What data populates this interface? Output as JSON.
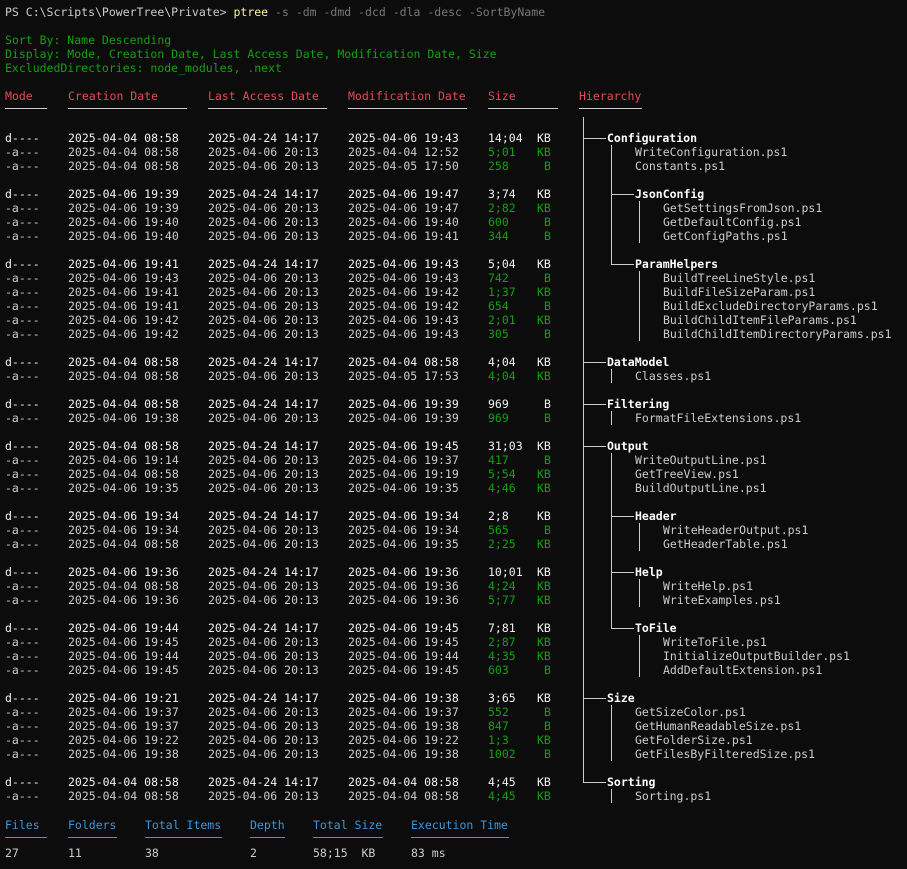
{
  "prompt": {
    "text": "PS C:\\Scripts\\PowerTree\\Private> ",
    "command": "ptree",
    "flags": " -s -dm -dmd -dcd -dla -desc -SortByName"
  },
  "info": {
    "sort": "Sort By: Name Descending",
    "display": "Display: Mode, Creation Date, Last Access Date, Modification Date, Size",
    "excluded": "ExcludedDirectories: node_modules, .next"
  },
  "headers": {
    "mode": "Mode",
    "creation": "Creation Date",
    "access": "Last Access Date",
    "modification": "Modification Date",
    "size": "Size",
    "hierarchy": "Hierarchy"
  },
  "rows": [
    {
      "mode": "d----",
      "c": "2025-04-04 08:58",
      "a": "2025-04-24 14:17",
      "m": "2025-04-06 19:43",
      "size": "14;04",
      "unit": "KB",
      "dir": true,
      "depth": 0,
      "name": "Configuration"
    },
    {
      "mode": "-a---",
      "c": "2025-04-04 08:58",
      "a": "2025-04-06 20:13",
      "m": "2025-04-04 12:52",
      "size": "5;01",
      "unit": "KB",
      "dir": false,
      "depth": 1,
      "name": "WriteConfiguration.ps1"
    },
    {
      "mode": "-a---",
      "c": "2025-04-04 08:58",
      "a": "2025-04-06 20:13",
      "m": "2025-04-05 17:50",
      "size": "258",
      "unit": "B",
      "dir": false,
      "depth": 1,
      "name": "Constants.ps1"
    },
    {
      "gap": true
    },
    {
      "mode": "d----",
      "c": "2025-04-06 19:39",
      "a": "2025-04-24 14:17",
      "m": "2025-04-06 19:47",
      "size": "3;74",
      "unit": "KB",
      "dir": true,
      "depth": 1,
      "name": "JsonConfig"
    },
    {
      "mode": "-a---",
      "c": "2025-04-06 19:39",
      "a": "2025-04-06 20:13",
      "m": "2025-04-06 19:47",
      "size": "2;82",
      "unit": "KB",
      "dir": false,
      "depth": 2,
      "name": "GetSettingsFromJson.ps1"
    },
    {
      "mode": "-a---",
      "c": "2025-04-06 19:40",
      "a": "2025-04-06 20:13",
      "m": "2025-04-06 19:40",
      "size": "600",
      "unit": "B",
      "dir": false,
      "depth": 2,
      "name": "GetDefaultConfig.ps1"
    },
    {
      "mode": "-a---",
      "c": "2025-04-06 19:40",
      "a": "2025-04-06 20:13",
      "m": "2025-04-06 19:41",
      "size": "344",
      "unit": "B",
      "dir": false,
      "depth": 2,
      "name": "GetConfigPaths.ps1"
    },
    {
      "gap": true
    },
    {
      "mode": "d----",
      "c": "2025-04-06 19:41",
      "a": "2025-04-24 14:17",
      "m": "2025-04-06 19:43",
      "size": "5;04",
      "unit": "KB",
      "dir": true,
      "depth": 1,
      "name": "ParamHelpers"
    },
    {
      "mode": "-a---",
      "c": "2025-04-06 19:43",
      "a": "2025-04-06 20:13",
      "m": "2025-04-06 19:43",
      "size": "742",
      "unit": "B",
      "dir": false,
      "depth": 2,
      "name": "BuildTreeLineStyle.ps1"
    },
    {
      "mode": "-a---",
      "c": "2025-04-06 19:41",
      "a": "2025-04-06 20:13",
      "m": "2025-04-06 19:42",
      "size": "1;37",
      "unit": "KB",
      "dir": false,
      "depth": 2,
      "name": "BuildFileSizeParam.ps1"
    },
    {
      "mode": "-a---",
      "c": "2025-04-06 19:41",
      "a": "2025-04-06 20:13",
      "m": "2025-04-06 19:42",
      "size": "654",
      "unit": "B",
      "dir": false,
      "depth": 2,
      "name": "BuildExcludeDirectoryParams.ps1"
    },
    {
      "mode": "-a---",
      "c": "2025-04-06 19:42",
      "a": "2025-04-06 20:13",
      "m": "2025-04-06 19:43",
      "size": "2;01",
      "unit": "KB",
      "dir": false,
      "depth": 2,
      "name": "BuildChildItemFileParams.ps1"
    },
    {
      "mode": "-a---",
      "c": "2025-04-06 19:42",
      "a": "2025-04-06 20:13",
      "m": "2025-04-06 19:43",
      "size": "305",
      "unit": "B",
      "dir": false,
      "depth": 2,
      "name": "BuildChildItemDirectoryParams.ps1"
    },
    {
      "gap": true
    },
    {
      "mode": "d----",
      "c": "2025-04-04 08:58",
      "a": "2025-04-24 14:17",
      "m": "2025-04-04 08:58",
      "size": "4;04",
      "unit": "KB",
      "dir": true,
      "depth": 0,
      "name": "DataModel"
    },
    {
      "mode": "-a---",
      "c": "2025-04-04 08:58",
      "a": "2025-04-06 20:13",
      "m": "2025-04-05 17:53",
      "size": "4;04",
      "unit": "KB",
      "dir": false,
      "depth": 1,
      "name": "Classes.ps1"
    },
    {
      "gap": true
    },
    {
      "mode": "d----",
      "c": "2025-04-04 08:58",
      "a": "2025-04-24 14:17",
      "m": "2025-04-06 19:39",
      "size": "969",
      "unit": "B",
      "dir": true,
      "depth": 0,
      "name": "Filtering"
    },
    {
      "mode": "-a---",
      "c": "2025-04-06 19:38",
      "a": "2025-04-06 20:13",
      "m": "2025-04-06 19:39",
      "size": "969",
      "unit": "B",
      "dir": false,
      "depth": 1,
      "name": "FormatFileExtensions.ps1"
    },
    {
      "gap": true
    },
    {
      "mode": "d----",
      "c": "2025-04-04 08:58",
      "a": "2025-04-24 14:17",
      "m": "2025-04-06 19:45",
      "size": "31;03",
      "unit": "KB",
      "dir": true,
      "depth": 0,
      "name": "Output"
    },
    {
      "mode": "-a---",
      "c": "2025-04-06 19:14",
      "a": "2025-04-06 20:13",
      "m": "2025-04-06 19:37",
      "size": "417",
      "unit": "B",
      "dir": false,
      "depth": 1,
      "name": "WriteOutputLine.ps1"
    },
    {
      "mode": "-a---",
      "c": "2025-04-04 08:58",
      "a": "2025-04-06 20:13",
      "m": "2025-04-06 19:19",
      "size": "5;54",
      "unit": "KB",
      "dir": false,
      "depth": 1,
      "name": "GetTreeView.ps1"
    },
    {
      "mode": "-a---",
      "c": "2025-04-06 19:35",
      "a": "2025-04-06 20:13",
      "m": "2025-04-06 19:35",
      "size": "4;46",
      "unit": "KB",
      "dir": false,
      "depth": 1,
      "name": "BuildOutputLine.ps1"
    },
    {
      "gap": true
    },
    {
      "mode": "d----",
      "c": "2025-04-06 19:34",
      "a": "2025-04-24 14:17",
      "m": "2025-04-06 19:34",
      "size": "2;8",
      "unit": "KB",
      "dir": true,
      "depth": 1,
      "name": "Header"
    },
    {
      "mode": "-a---",
      "c": "2025-04-06 19:34",
      "a": "2025-04-06 20:13",
      "m": "2025-04-06 19:34",
      "size": "565",
      "unit": "B",
      "dir": false,
      "depth": 2,
      "name": "WriteHeaderOutput.ps1"
    },
    {
      "mode": "-a---",
      "c": "2025-04-04 08:58",
      "a": "2025-04-06 20:13",
      "m": "2025-04-06 19:35",
      "size": "2;25",
      "unit": "KB",
      "dir": false,
      "depth": 2,
      "name": "GetHeaderTable.ps1"
    },
    {
      "gap": true
    },
    {
      "mode": "d----",
      "c": "2025-04-06 19:36",
      "a": "2025-04-24 14:17",
      "m": "2025-04-06 19:36",
      "size": "10;01",
      "unit": "KB",
      "dir": true,
      "depth": 1,
      "name": "Help"
    },
    {
      "mode": "-a---",
      "c": "2025-04-04 08:58",
      "a": "2025-04-06 20:13",
      "m": "2025-04-06 19:36",
      "size": "4;24",
      "unit": "KB",
      "dir": false,
      "depth": 2,
      "name": "WriteHelp.ps1"
    },
    {
      "mode": "-a---",
      "c": "2025-04-06 19:36",
      "a": "2025-04-06 20:13",
      "m": "2025-04-06 19:36",
      "size": "5;77",
      "unit": "KB",
      "dir": false,
      "depth": 2,
      "name": "WriteExamples.ps1"
    },
    {
      "gap": true
    },
    {
      "mode": "d----",
      "c": "2025-04-06 19:44",
      "a": "2025-04-24 14:17",
      "m": "2025-04-06 19:45",
      "size": "7;81",
      "unit": "KB",
      "dir": true,
      "depth": 1,
      "name": "ToFile"
    },
    {
      "mode": "-a---",
      "c": "2025-04-06 19:45",
      "a": "2025-04-06 20:13",
      "m": "2025-04-06 19:45",
      "size": "2;87",
      "unit": "KB",
      "dir": false,
      "depth": 2,
      "name": "WriteToFile.ps1"
    },
    {
      "mode": "-a---",
      "c": "2025-04-06 19:44",
      "a": "2025-04-06 20:13",
      "m": "2025-04-06 19:44",
      "size": "4;35",
      "unit": "KB",
      "dir": false,
      "depth": 2,
      "name": "InitializeOutputBuilder.ps1"
    },
    {
      "mode": "-a---",
      "c": "2025-04-06 19:45",
      "a": "2025-04-06 20:13",
      "m": "2025-04-06 19:45",
      "size": "603",
      "unit": "B",
      "dir": false,
      "depth": 2,
      "name": "AddDefaultExtension.ps1"
    },
    {
      "gap": true
    },
    {
      "mode": "d----",
      "c": "2025-04-06 19:21",
      "a": "2025-04-24 14:17",
      "m": "2025-04-06 19:38",
      "size": "3;65",
      "unit": "KB",
      "dir": true,
      "depth": 0,
      "name": "Size"
    },
    {
      "mode": "-a---",
      "c": "2025-04-06 19:37",
      "a": "2025-04-06 20:13",
      "m": "2025-04-06 19:37",
      "size": "552",
      "unit": "B",
      "dir": false,
      "depth": 1,
      "name": "GetSizeColor.ps1"
    },
    {
      "mode": "-a---",
      "c": "2025-04-06 19:37",
      "a": "2025-04-06 20:13",
      "m": "2025-04-06 19:38",
      "size": "847",
      "unit": "B",
      "dir": false,
      "depth": 1,
      "name": "GetHumanReadableSize.ps1"
    },
    {
      "mode": "-a---",
      "c": "2025-04-06 19:22",
      "a": "2025-04-06 20:13",
      "m": "2025-04-06 19:22",
      "size": "1;3",
      "unit": "KB",
      "dir": false,
      "depth": 1,
      "name": "GetFolderSize.ps1"
    },
    {
      "mode": "-a---",
      "c": "2025-04-06 19:38",
      "a": "2025-04-06 20:13",
      "m": "2025-04-06 19:38",
      "size": "1002",
      "unit": "B",
      "dir": false,
      "depth": 1,
      "name": "GetFilesByFilteredSize.ps1"
    },
    {
      "gap": true
    },
    {
      "mode": "d----",
      "c": "2025-04-04 08:58",
      "a": "2025-04-24 14:17",
      "m": "2025-04-04 08:58",
      "size": "4;45",
      "unit": "KB",
      "dir": true,
      "depth": 0,
      "name": "Sorting"
    },
    {
      "mode": "-a---",
      "c": "2025-04-04 08:58",
      "a": "2025-04-06 20:13",
      "m": "2025-04-04 08:58",
      "size": "4;45",
      "unit": "KB",
      "dir": false,
      "depth": 1,
      "name": "Sorting.ps1"
    }
  ],
  "footer": {
    "headers": {
      "files": "Files",
      "folders": "Folders",
      "total": "Total Items",
      "depth": "Depth",
      "size": "Total Size",
      "time": "Execution Time"
    },
    "values": {
      "files": "27",
      "folders": "11",
      "total": "38",
      "depth": "2",
      "size": "58;15  KB",
      "time": "83 ms"
    }
  },
  "colors": {
    "header": "#e74856",
    "footer": "#3a96dd",
    "info": "#13a10e",
    "size_file": "#13a10e",
    "background": "#0c0c0c"
  }
}
